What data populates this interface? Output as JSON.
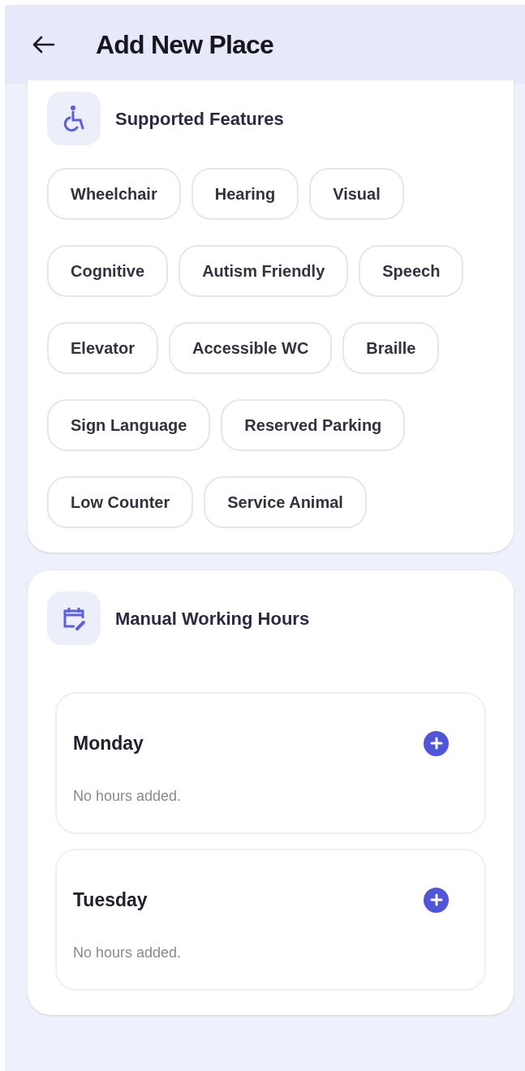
{
  "app_bar": {
    "title": "Add New Place"
  },
  "features": {
    "title": "Supported Features",
    "chips": [
      {
        "label": "Wheelchair",
        "selected": false
      },
      {
        "label": "Hearing",
        "selected": false
      },
      {
        "label": "Visual",
        "selected": false
      },
      {
        "label": "Cognitive",
        "selected": false
      },
      {
        "label": "Autism Friendly",
        "selected": false
      },
      {
        "label": "Speech",
        "selected": false
      },
      {
        "label": "Elevator",
        "selected": false
      },
      {
        "label": "Accessible WC",
        "selected": false
      },
      {
        "label": "Braille",
        "selected": false
      },
      {
        "label": "Sign Language",
        "selected": false
      },
      {
        "label": "Reserved Parking",
        "selected": false
      },
      {
        "label": "Low Counter",
        "selected": false
      },
      {
        "label": "Service Animal",
        "selected": false
      }
    ]
  },
  "working_hours": {
    "title": "Manual Working Hours",
    "days": [
      {
        "day": "Monday",
        "note": "No hours added."
      },
      {
        "day": "Tuesday",
        "note": "No hours added."
      }
    ]
  }
}
